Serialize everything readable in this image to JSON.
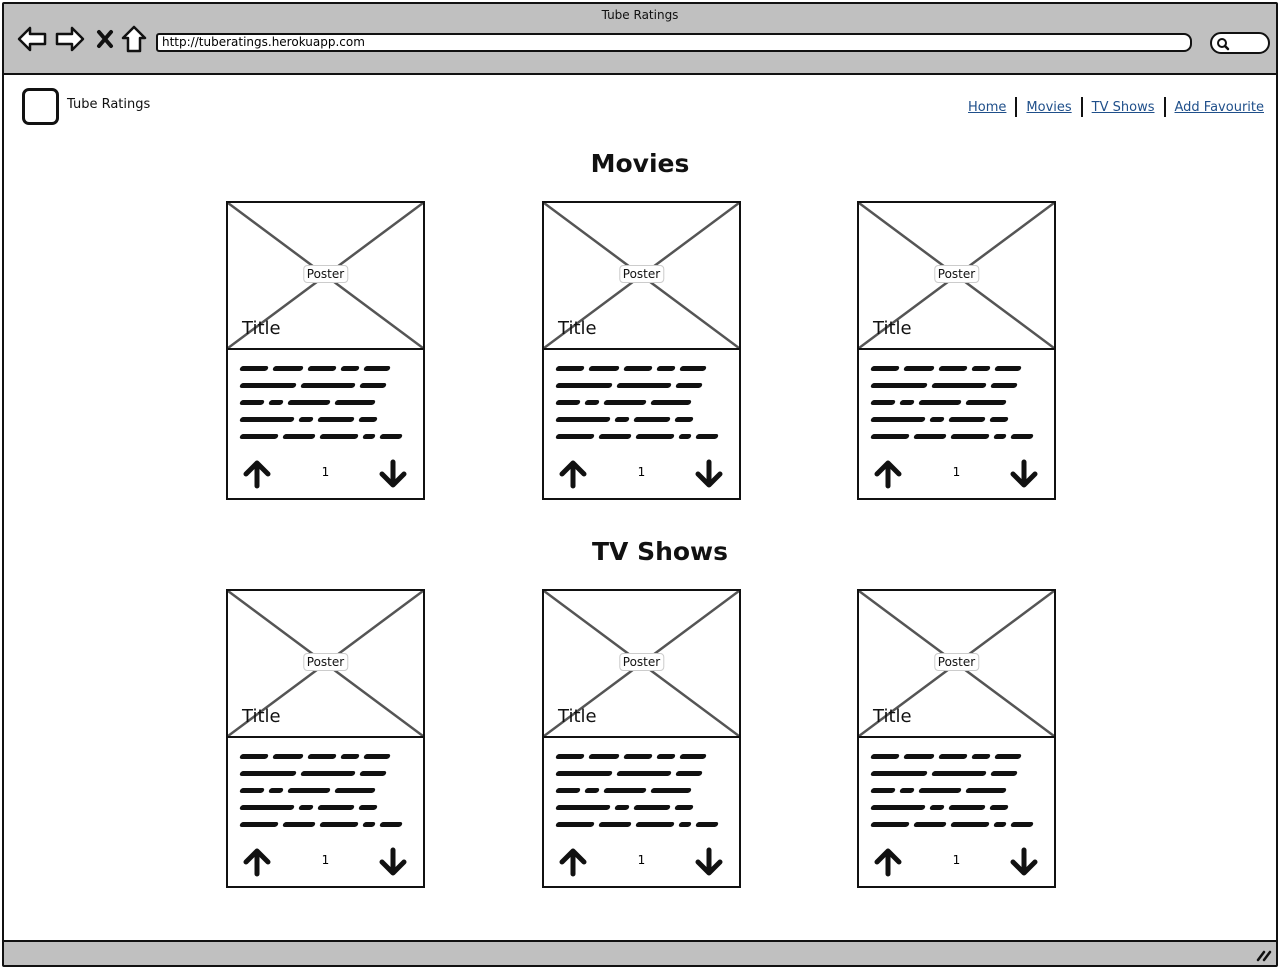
{
  "window": {
    "title": "Tube Ratings",
    "url": "http://tuberatings.herokuapp.com"
  },
  "header": {
    "brand": "Tube Ratings",
    "nav": [
      {
        "label": "Home"
      },
      {
        "label": "Movies"
      },
      {
        "label": "TV Shows"
      },
      {
        "label": "Add Favourite"
      }
    ]
  },
  "sections": [
    {
      "title": "Movies",
      "cards": [
        {
          "poster_label": "Poster",
          "title": "Title",
          "votes": "1"
        },
        {
          "poster_label": "Poster",
          "title": "Title",
          "votes": "1"
        },
        {
          "poster_label": "Poster",
          "title": "Title",
          "votes": "1"
        }
      ]
    },
    {
      "title": "TV Shows",
      "cards": [
        {
          "poster_label": "Poster",
          "title": "Title",
          "votes": "1"
        },
        {
          "poster_label": "Poster",
          "title": "Title",
          "votes": "1"
        },
        {
          "poster_label": "Poster",
          "title": "Title",
          "votes": "1"
        }
      ]
    }
  ],
  "icons": {
    "back": "back-arrow-icon",
    "forward": "forward-arrow-icon",
    "stop": "close-icon",
    "home": "home-icon",
    "search": "search-icon",
    "vote_up": "arrow-up-icon",
    "vote_down": "arrow-down-icon",
    "grip": "resize-grip-icon"
  },
  "colors": {
    "chrome": "#c0c0c0",
    "link": "#1f4f8a",
    "stroke": "#111111"
  }
}
